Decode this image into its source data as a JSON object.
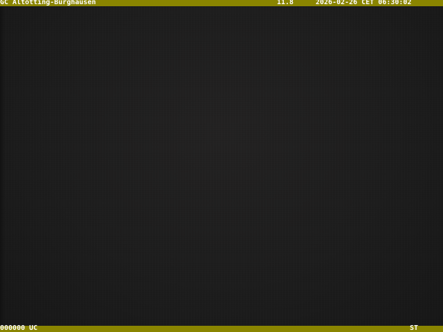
{
  "overlay_top": {
    "station": "GC Altötting-Burghausen",
    "temperature": "11.8",
    "datetime": "2026-02-26 CET 06:30:02"
  },
  "overlay_bottom": {
    "counter": "000000 UC",
    "code": "ST"
  },
  "colors": {
    "bar": "#8a8500",
    "image_dark": "#1c1c1c",
    "text": "#ffffff"
  }
}
